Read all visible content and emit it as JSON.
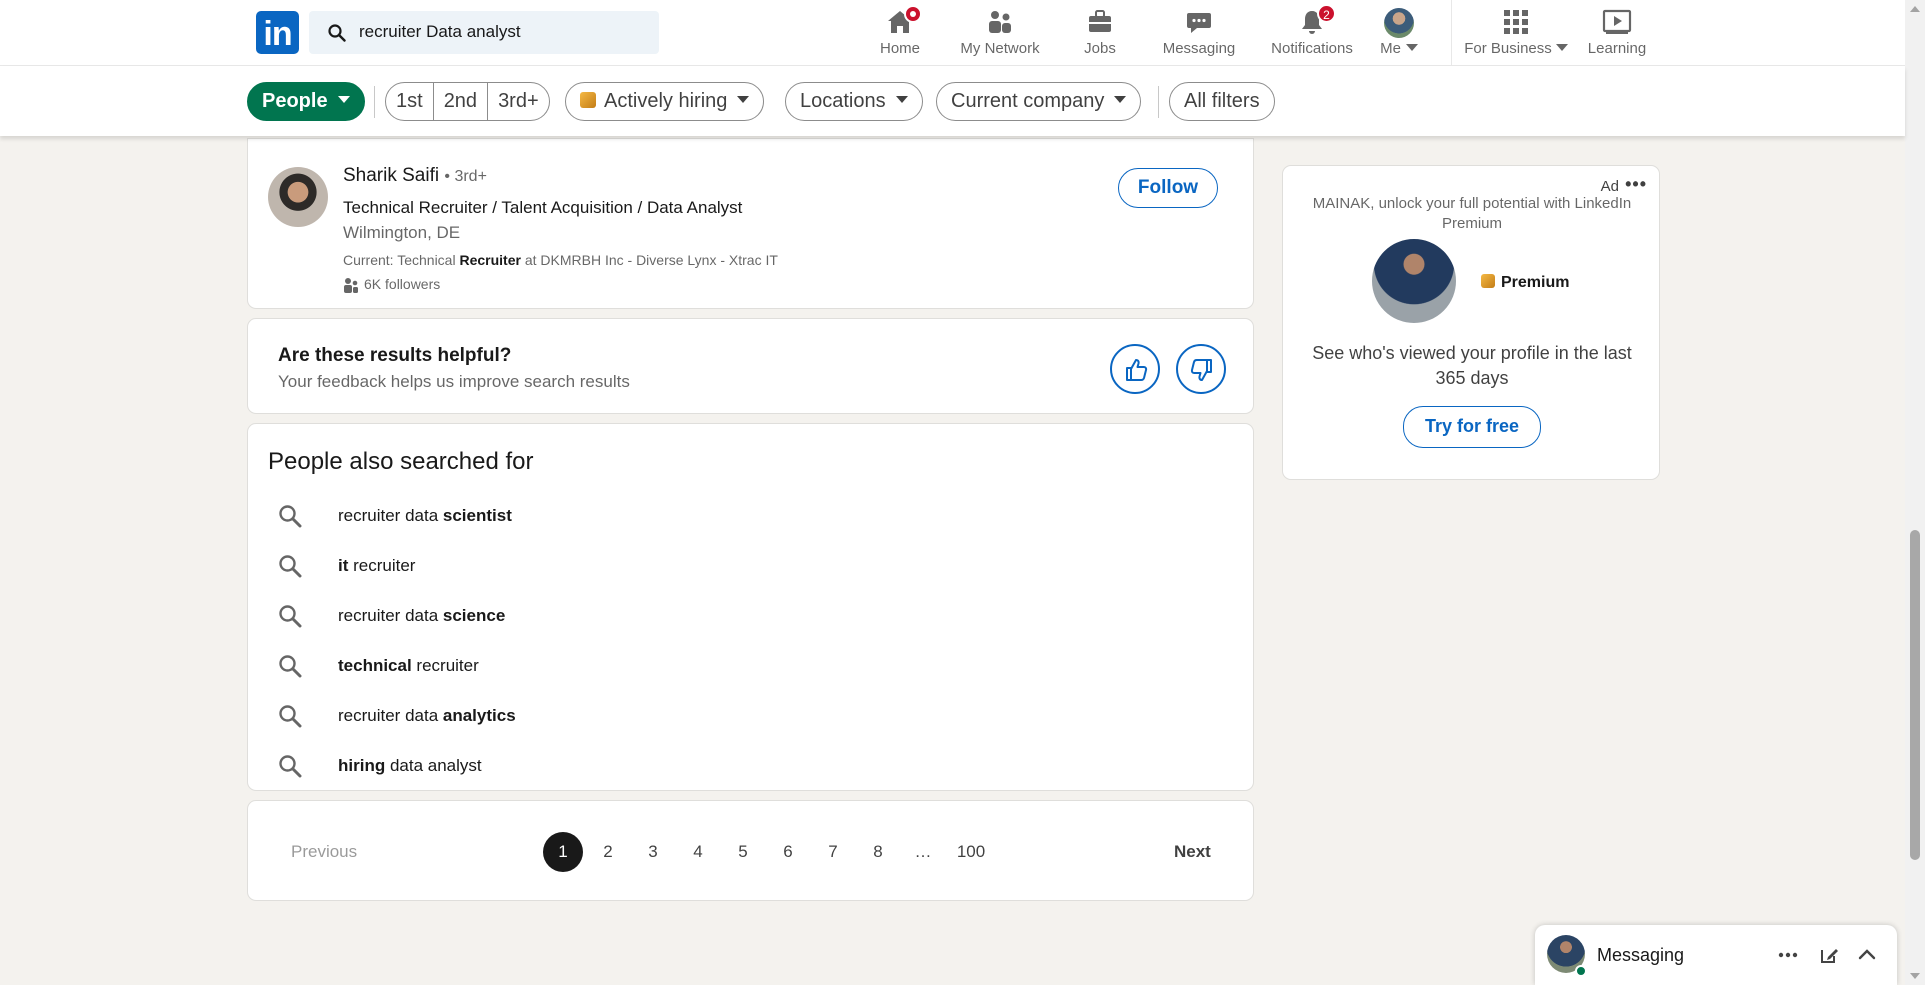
{
  "nav": {
    "search_value": "recruiter Data analyst",
    "items": [
      {
        "label": "Home"
      },
      {
        "label": "My Network"
      },
      {
        "label": "Jobs"
      },
      {
        "label": "Messaging"
      },
      {
        "label": "Notifications",
        "badge": "2"
      },
      {
        "label": "Me"
      },
      {
        "label": "For Business"
      },
      {
        "label": "Learning"
      }
    ]
  },
  "filters": {
    "people": "People",
    "connections": [
      "1st",
      "2nd",
      "3rd+"
    ],
    "actively_hiring": "Actively hiring",
    "locations": "Locations",
    "current_company": "Current company",
    "all_filters": "All filters"
  },
  "result": {
    "name": "Sharik Saifi",
    "degree": "• 3rd+",
    "headline": "Technical Recruiter / Talent Acquisition / Data Analyst",
    "location": "Wilmington, DE",
    "current_prefix": "Current: Technical ",
    "current_bold": "Recruiter",
    "current_suffix": " at DKMRBH Inc - Diverse Lynx - Xtrac IT",
    "followers": "6K followers",
    "follow_label": "Follow"
  },
  "feedback": {
    "title": "Are these results helpful?",
    "subtitle": "Your feedback helps us improve search results"
  },
  "related": {
    "title": "People also searched for",
    "items": [
      {
        "pre": "recruiter data ",
        "bold": "scientist",
        "post": ""
      },
      {
        "pre": "",
        "bold": "it",
        "post": " recruiter"
      },
      {
        "pre": "recruiter data ",
        "bold": "science",
        "post": ""
      },
      {
        "pre": "",
        "bold": "technical",
        "post": " recruiter"
      },
      {
        "pre": "recruiter data ",
        "bold": "analytics",
        "post": ""
      },
      {
        "pre": "",
        "bold": "hiring",
        "post": " data analyst"
      }
    ]
  },
  "pagination": {
    "previous": "Previous",
    "next": "Next",
    "pages": [
      "1",
      "2",
      "3",
      "4",
      "5",
      "6",
      "7",
      "8",
      "…",
      "100"
    ],
    "current": "1"
  },
  "ad": {
    "label": "Ad",
    "more": "•••",
    "lead": "MAINAK, unlock your full potential with LinkedIn Premium",
    "premium": "Premium",
    "body": "See who's viewed your profile in the last 365 days",
    "cta": "Try for free"
  },
  "messaging": {
    "title": "Messaging"
  },
  "colors": {
    "brand": "#0a66c2",
    "active_filter": "#01754f",
    "badge": "#cb112d"
  }
}
